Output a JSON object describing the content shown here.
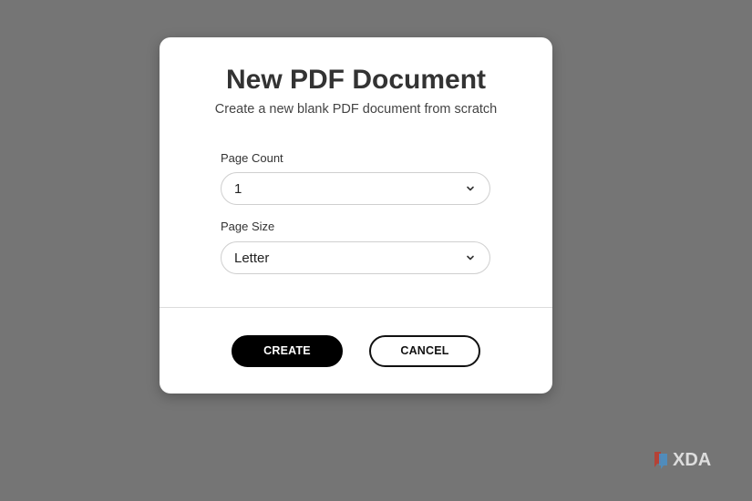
{
  "dialog": {
    "title": "New PDF Document",
    "subtitle": "Create a new blank PDF document from scratch",
    "page_count": {
      "label": "Page Count",
      "value": "1"
    },
    "page_size": {
      "label": "Page Size",
      "value": "Letter"
    },
    "create_label": "CREATE",
    "cancel_label": "CANCEL"
  },
  "watermark": {
    "text": "XDA",
    "icon": "xda-logo-icon"
  },
  "colors": {
    "backdrop": "#757575",
    "primary_button": "#000000",
    "dialog_background": "#ffffff"
  }
}
